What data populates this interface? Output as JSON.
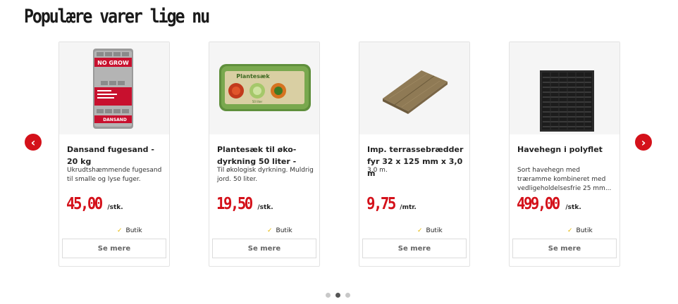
{
  "section": {
    "title": "Populære varer lige nu"
  },
  "carousel": {
    "prev_icon": "chevron-left-icon",
    "next_icon": "chevron-right-icon",
    "prev_glyph": "‹",
    "next_glyph": "›",
    "accent": "#d4111a",
    "dots": [
      {
        "active": false
      },
      {
        "active": true
      },
      {
        "active": false
      }
    ]
  },
  "products": [
    {
      "name": "Dansand fugesand - 20 kg",
      "description": "Ukrudtshæmmende fugesand til smalle og lyse fuger.",
      "price": "45,00",
      "unit": "/stk.",
      "stock_label": "Butik",
      "stock_icon": "check-icon",
      "button_label": "Se mere",
      "image": "sand-bag-image",
      "image_text": {
        "brand": "NO GROW",
        "maker": "DANSAND"
      }
    },
    {
      "name": "Plantesæk til øko-dyrkning 50 liter -",
      "description": "Til økologisk dyrkning. Muldrig jord. 50 liter.",
      "price": "19,50",
      "unit": "/stk.",
      "stock_label": "Butik",
      "stock_icon": "check-icon",
      "button_label": "Se mere",
      "image": "plant-sack-image",
      "image_text": {
        "label": "Plantesæk",
        "volume": "50 liter"
      }
    },
    {
      "name": "Imp. terrassebrædder fyr 32 x 125 mm x 3,0 m",
      "description": "3,0 m.",
      "price": "9,75",
      "unit": "/mtr.",
      "stock_label": "Butik",
      "stock_icon": "check-icon",
      "button_label": "Se mere",
      "image": "decking-board-image"
    },
    {
      "name": "Havehegn i polyflet",
      "description": "Sort havehegn med træramme kombineret med vedligeholdelsesfrie 25 mm...",
      "price": "499,00",
      "unit": "/stk.",
      "stock_label": "Butik",
      "stock_icon": "check-icon",
      "button_label": "Se mere",
      "image": "fence-panel-image"
    }
  ]
}
